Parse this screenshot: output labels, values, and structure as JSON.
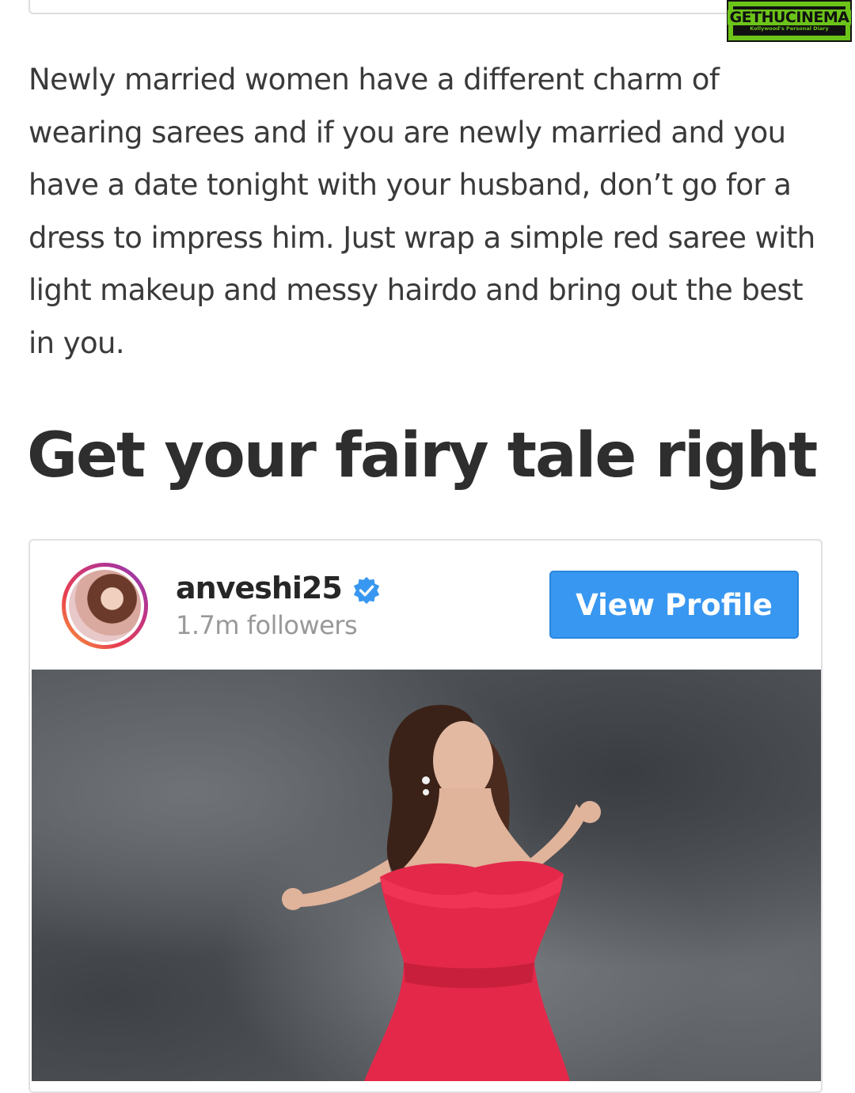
{
  "watermark": {
    "brand": "GETHUCINEMA",
    "tagline": "Kollywood's Personal Diary"
  },
  "article": {
    "paragraph": "Newly married women have a different charm of wearing sarees and if you are newly married and you have a date tonight with your husband, don’t go for a dress to impress him. Just wrap a simple red saree with light makeup and messy hairdo and bring out the best in you.",
    "heading": "Get your fairy tale right"
  },
  "embed": {
    "username": "anveshi25",
    "verified_icon": "verified-badge-icon",
    "followers": "1.7m followers",
    "button_label": "View Profile",
    "button_color": "#3897f0",
    "ring_colors": [
      "#f9a43a",
      "#e8404f",
      "#c13584",
      "#8a3ab9"
    ],
    "photo_alt": "woman in red off-shoulder dress against grey backdrop"
  }
}
